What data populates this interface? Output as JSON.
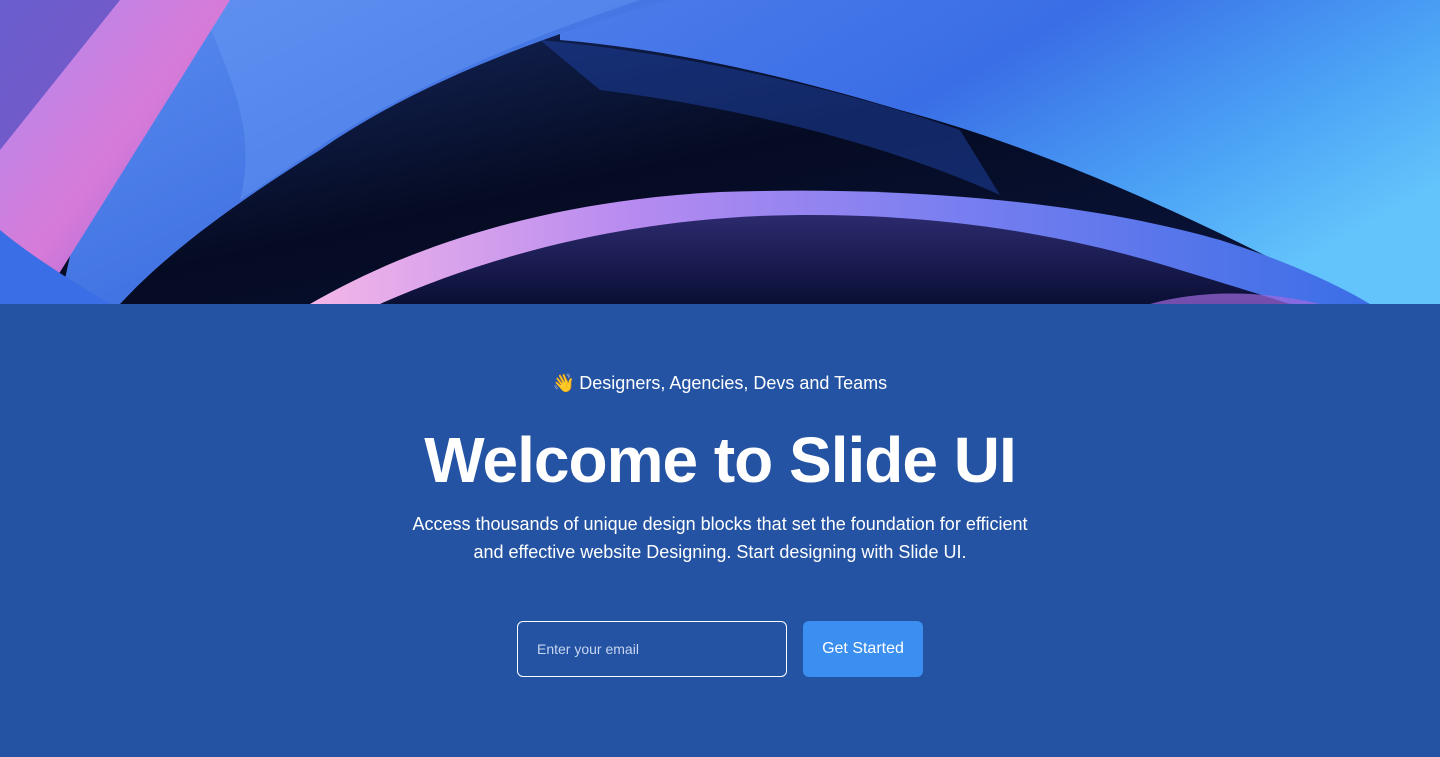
{
  "hero": {
    "image_description_icon": "abstract-waves-image",
    "tagline_icon": "waving-hand-icon",
    "tagline_emoji": "👋",
    "tagline": "Designers, Agencies, Devs and Teams",
    "title": "Welcome to Slide UI",
    "description": "Access thousands of unique design blocks that set the foundation for efficient and effective website Designing. Start designing with Slide UI."
  },
  "signup": {
    "email_placeholder": "Enter your email",
    "email_value": "",
    "button_label": "Get Started"
  },
  "colors": {
    "section_background": "#2453a3",
    "button_background": "#3b8ff0",
    "text": "#ffffff"
  }
}
